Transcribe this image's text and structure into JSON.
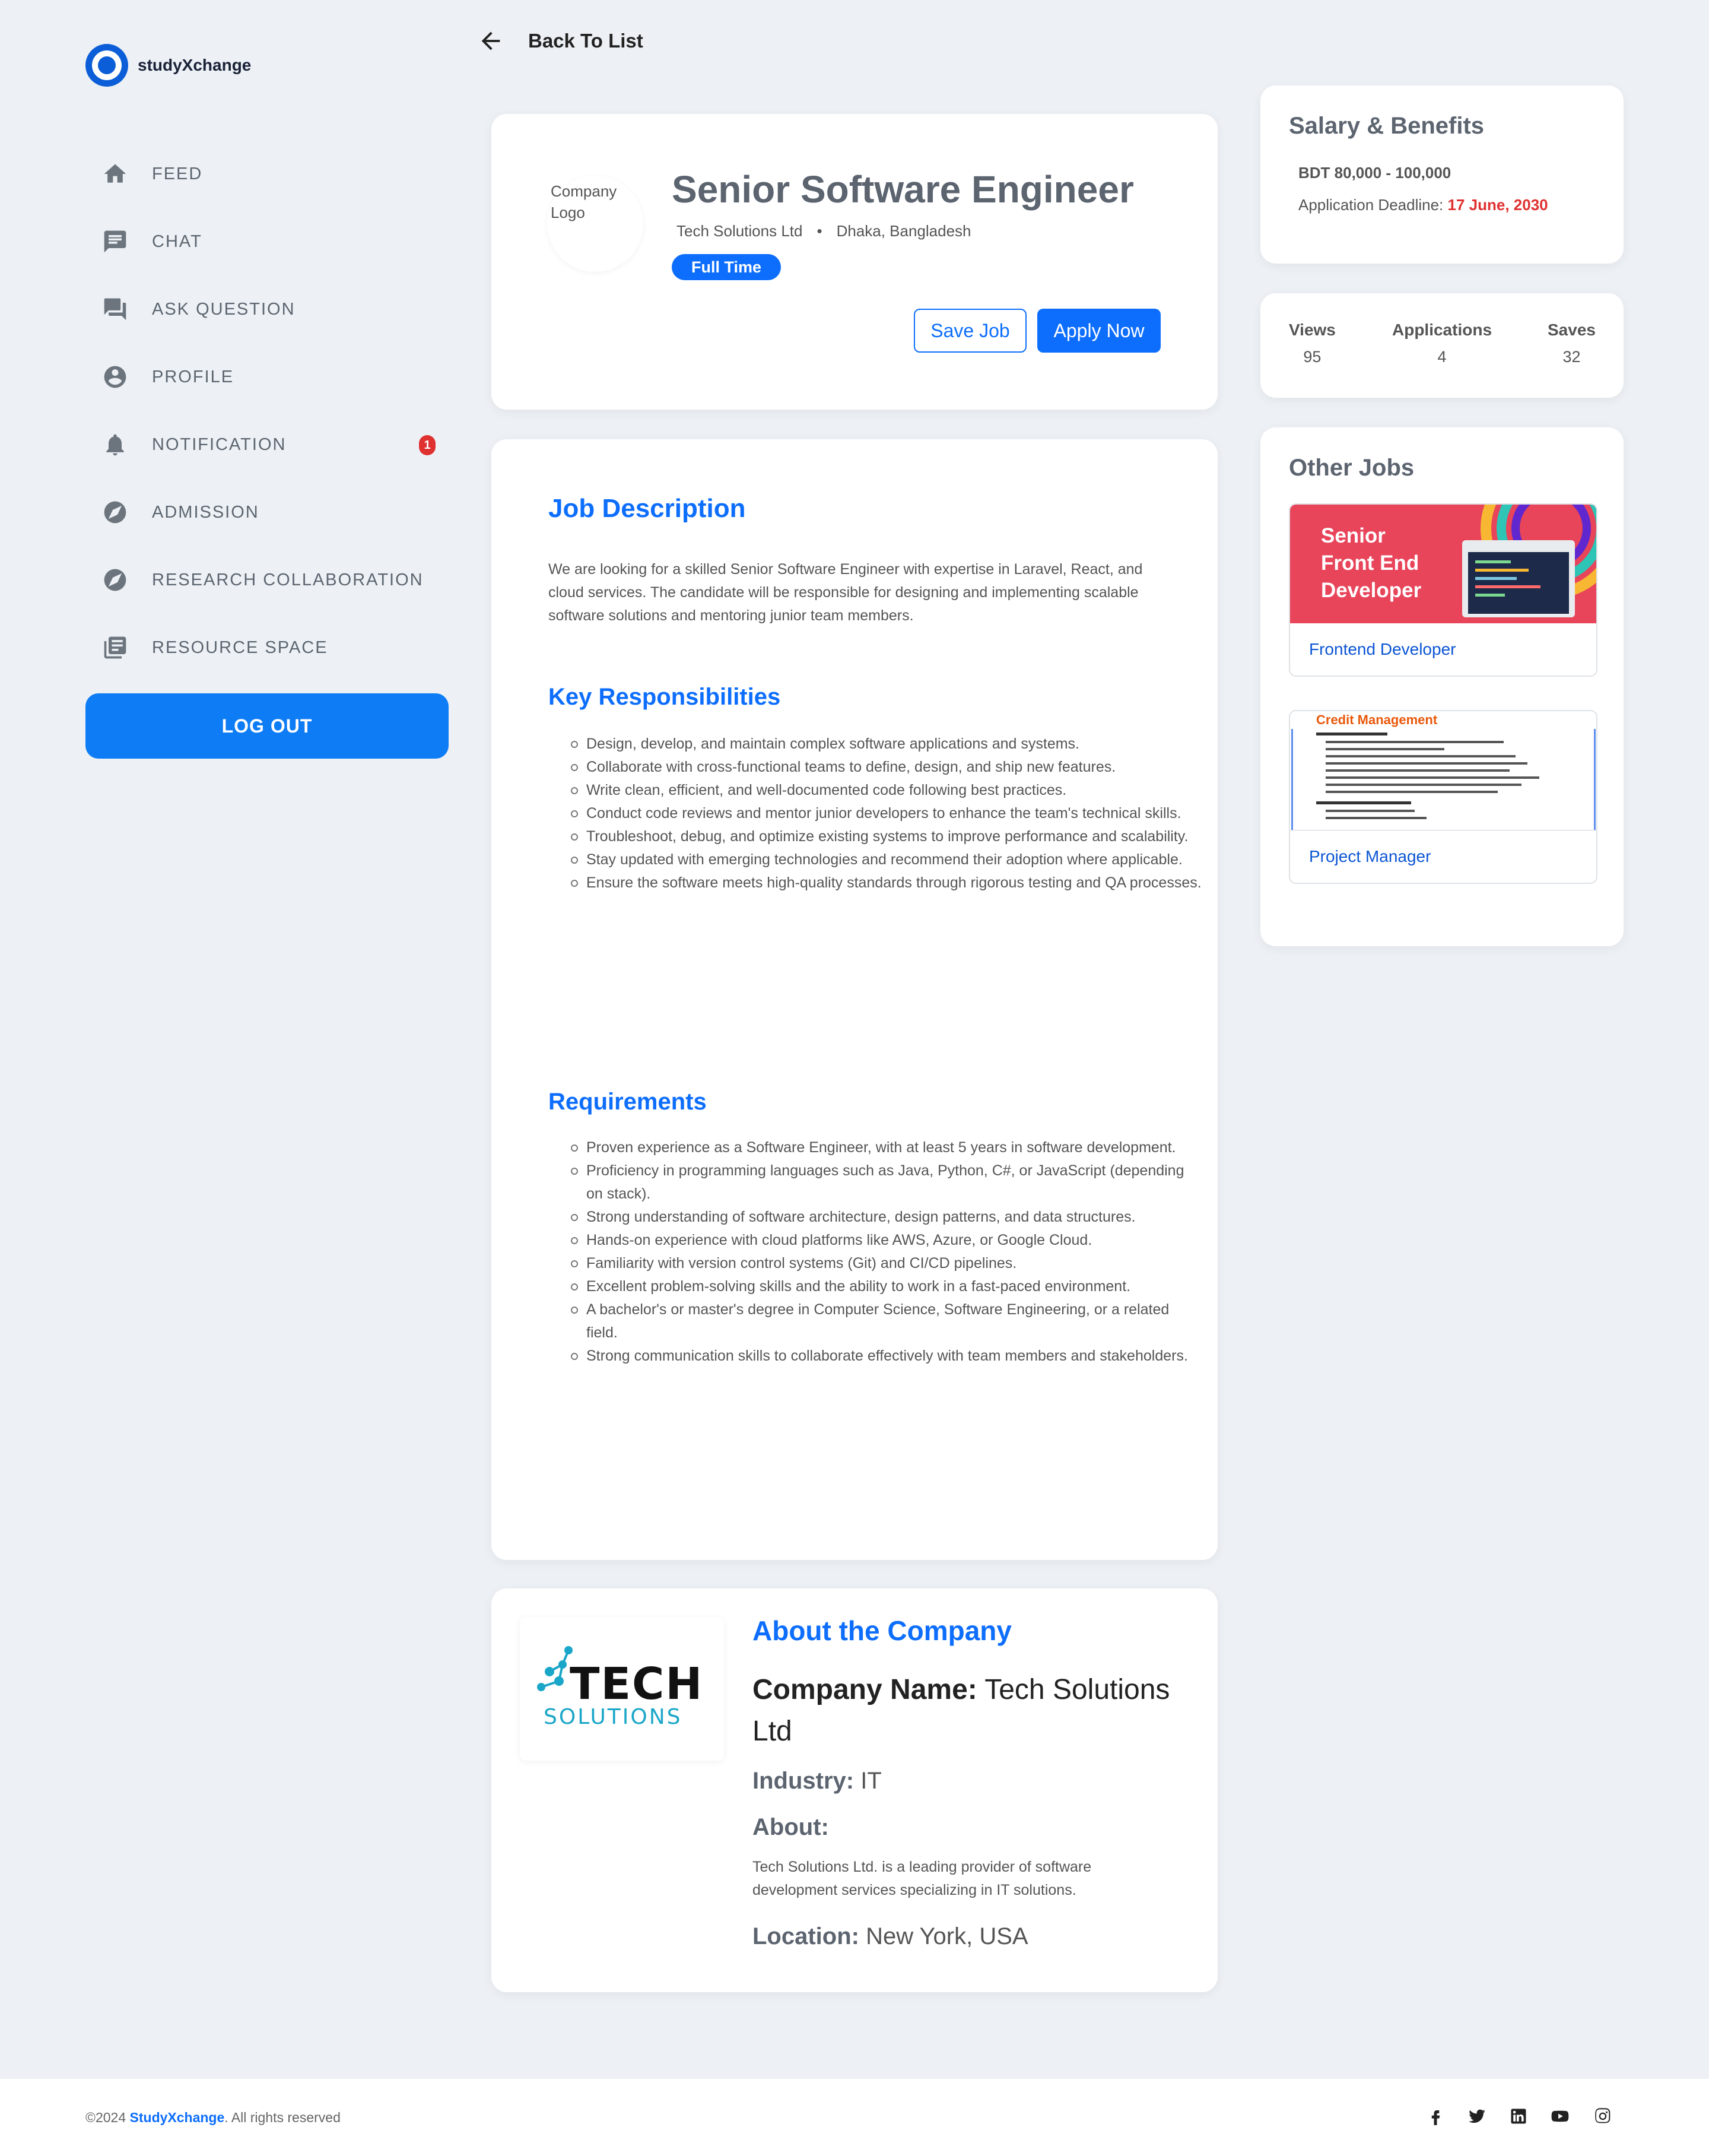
{
  "brand": {
    "name": "studyXchange"
  },
  "sidebar": {
    "items": [
      {
        "label": "FEED",
        "icon": "home-icon"
      },
      {
        "label": "CHAT",
        "icon": "chat-icon"
      },
      {
        "label": "ASK QUESTION",
        "icon": "forum-icon"
      },
      {
        "label": "PROFILE",
        "icon": "account-icon"
      },
      {
        "label": "NOTIFICATION",
        "icon": "bell-icon",
        "badge": "1"
      },
      {
        "label": "ADMISSION",
        "icon": "compass-icon"
      },
      {
        "label": "RESEARCH COLLABORATION",
        "icon": "compass-icon"
      },
      {
        "label": "RESOURCE SPACE",
        "icon": "library-icon"
      }
    ],
    "logout_label": "LOG OUT"
  },
  "back_label": "Back To List",
  "job": {
    "logo_alt": "Company Logo",
    "title": "Senior Software Engineer",
    "company": "Tech Solutions Ltd",
    "separator": "•",
    "location": "Dhaka, Bangladesh",
    "type": "Full Time",
    "save_label": "Save Job",
    "apply_label": "Apply Now"
  },
  "description": {
    "heading": "Job Description",
    "text": "We are looking for a skilled Senior Software Engineer with expertise in Laravel, React, and cloud services. The candidate will be responsible for designing and implementing scalable software solutions and mentoring junior team members.",
    "responsibilities_heading": "Key Responsibilities",
    "responsibilities": [
      "Design, develop, and maintain complex software applications and systems.",
      "Collaborate with cross-functional teams to define, design, and ship new features.",
      "Write clean, efficient, and well-documented code following best practices.",
      "Conduct code reviews and mentor junior developers to enhance the team's technical skills.",
      "Troubleshoot, debug, and optimize existing systems to improve performance and scalability.",
      "Stay updated with emerging technologies and recommend their adoption where applicable.",
      "Ensure the software meets high-quality standards through rigorous testing and QA processes."
    ],
    "requirements_heading": "Requirements",
    "requirements": [
      "Proven experience as a Software Engineer, with at least 5 years in software development.",
      "Proficiency in programming languages such as Java, Python, C#, or JavaScript (depending on stack).",
      "Strong understanding of software architecture, design patterns, and data structures.",
      "Hands-on experience with cloud platforms like AWS, Azure, or Google Cloud.",
      "Familiarity with version control systems (Git) and CI/CD pipelines.",
      "Excellent problem-solving skills and the ability to work in a fast-paced environment.",
      "A bachelor's or master's degree in Computer Science, Software Engineering, or a related field.",
      "Strong communication skills to collaborate effectively with team members and stakeholders."
    ]
  },
  "about": {
    "heading": "About the Company",
    "logo_text_top": "TECH",
    "logo_text_bottom": "SOLUTIONS",
    "name_label": "Company Name:",
    "name_value": "Tech Solutions Ltd",
    "industry_label": "Industry:",
    "industry_value": "IT",
    "about_label": "About:",
    "about_text": "Tech Solutions Ltd. is a leading provider of software development services specializing in IT solutions.",
    "location_label": "Location:",
    "location_value": "New York, USA"
  },
  "salary": {
    "heading": "Salary & Benefits",
    "range": "BDT 80,000 - 100,000",
    "deadline_label": "Application Deadline:",
    "deadline_value": "17 June, 2030",
    "deadline_color": "#e03131"
  },
  "stats": [
    {
      "label": "Views",
      "value": "95"
    },
    {
      "label": "Applications",
      "value": "4"
    },
    {
      "label": "Saves",
      "value": "32"
    }
  ],
  "other_jobs": {
    "heading": "Other Jobs",
    "items": [
      {
        "banner_text": [
          "Senior",
          "Front End",
          "Developer"
        ],
        "link": "Frontend Developer"
      },
      {
        "banner_title": "Credit Management",
        "link": "Project Manager"
      }
    ]
  },
  "footer": {
    "copyright": "©2024",
    "brand": "StudyXchange",
    "rights": ". All rights reserved",
    "social": [
      "facebook-icon",
      "twitter-icon",
      "linkedin-icon",
      "youtube-icon",
      "instagram-icon"
    ]
  },
  "colors": {
    "accent": "#0d6efd",
    "logout": "#0d7cf5",
    "danger": "#e03131"
  }
}
